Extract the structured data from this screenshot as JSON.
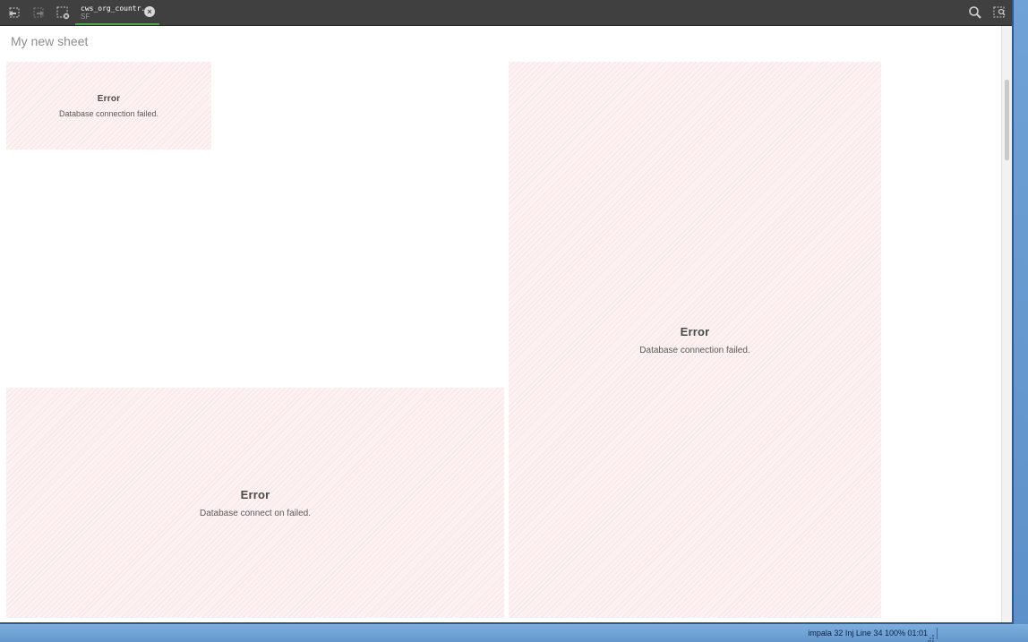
{
  "toolbar": {
    "buttons": [
      {
        "icon": "back-icon"
      },
      {
        "icon": "forward-icon"
      },
      {
        "icon": "clear-selections-icon"
      }
    ],
    "tab": {
      "title": "cws_org_countr...",
      "subtitle": "SF"
    },
    "right_buttons": [
      {
        "icon": "search-icon"
      },
      {
        "icon": "smart-search-icon"
      }
    ]
  },
  "sheet": {
    "title": "My new sheet"
  },
  "panels": [
    {
      "title": "Error",
      "message": "Database connection failed."
    },
    {
      "title": "Error",
      "message": "Database connection failed."
    },
    {
      "title": "Error",
      "message": "Database connect on failed."
    }
  ],
  "statusbar": {
    "text": "impala 32 Inj Line 34 100% 01:01"
  },
  "colors": {
    "toolbar_bg": "#404040",
    "tab_indicator": "#52a14a",
    "panel_bg": "#fdf3f3",
    "panel_hatch": "#e68c8c"
  }
}
